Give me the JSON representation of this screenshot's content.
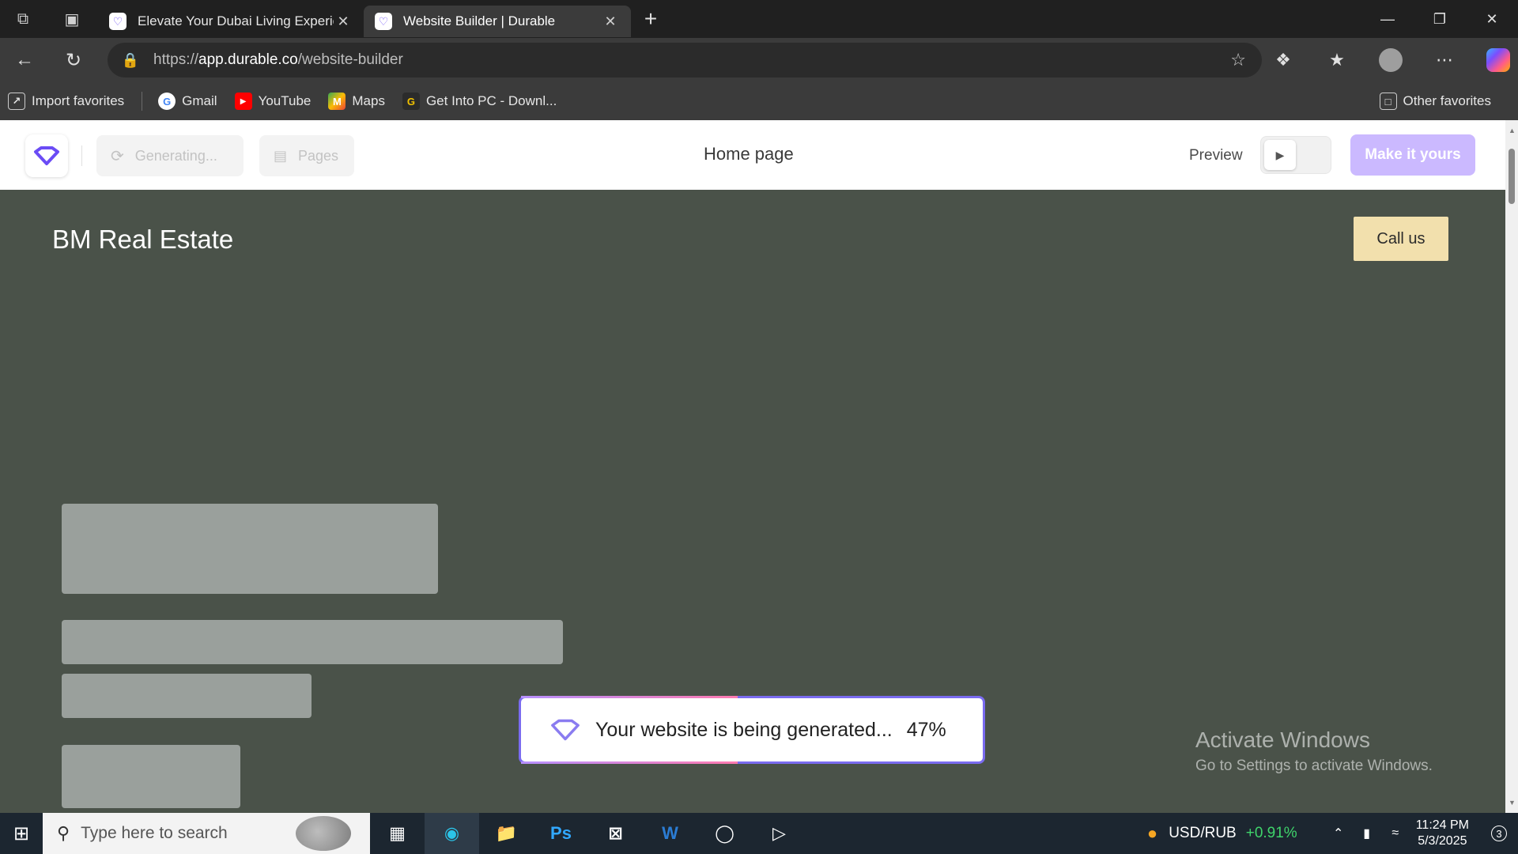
{
  "browser": {
    "tabs": [
      {
        "label": "Elevate Your Dubai Living Experie",
        "active": false
      },
      {
        "label": "Website Builder | Durable",
        "active": true
      }
    ],
    "url_prefix": "https://",
    "url_host": "app.durable.co",
    "url_path": "/website-builder",
    "bookmarks": [
      {
        "label": "Import favorites",
        "icon": "import-icon"
      },
      {
        "label": "Gmail",
        "icon": "google-icon"
      },
      {
        "label": "YouTube",
        "icon": "youtube-icon"
      },
      {
        "label": "Maps",
        "icon": "maps-icon"
      },
      {
        "label": "Get Into PC - Downl...",
        "icon": "getintopc-icon"
      }
    ],
    "other_favorites": "Other favorites"
  },
  "builder": {
    "generating_label": "Generating...",
    "pages_label": "Pages",
    "page_title": "Home page",
    "preview_label": "Preview",
    "make_it_yours_label": "Make it yours",
    "accent": "#cbb9ff"
  },
  "site": {
    "title": "BM Real Estate",
    "call_label": "Call us",
    "background": "#4a5249",
    "button_color": "#f2e0ad"
  },
  "toast": {
    "message": "Your website is being generated...",
    "percent": "47%",
    "progress": 0.47
  },
  "watermark": {
    "line1": "Activate Windows",
    "line2": "Go to Settings to activate Windows."
  },
  "taskbar": {
    "search_placeholder": "Type here to search",
    "ticker_label": "USD/RUB",
    "ticker_change": "+0.91%",
    "time": "11:24 PM",
    "date": "5/3/2025",
    "notifications": "3"
  }
}
